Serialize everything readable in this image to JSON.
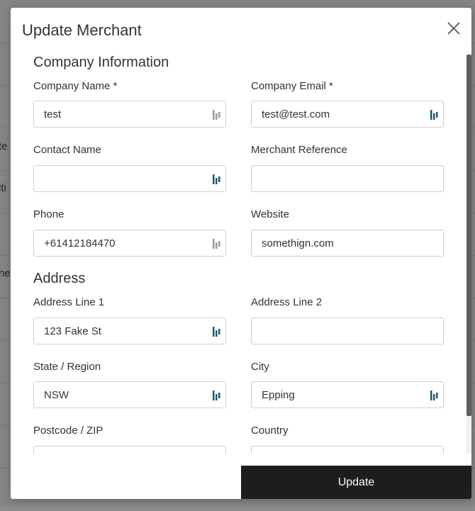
{
  "background": {
    "fragments": [
      "te",
      "lti",
      "ne"
    ]
  },
  "modal": {
    "title": "Update Merchant",
    "close_icon": "close-icon",
    "submit_label": "Update"
  },
  "sections": {
    "company": "Company Information",
    "address": "Address"
  },
  "fields": {
    "company_name": {
      "label": "Company Name *",
      "value": ""
    },
    "company_email": {
      "label": "Company Email *",
      "value": "test@test.com"
    },
    "contact_name": {
      "label": "Contact Name",
      "value": ""
    },
    "merchant_reference": {
      "label": "Merchant Reference",
      "value": ""
    },
    "phone": {
      "label": "Phone",
      "value": "+61412184470"
    },
    "website": {
      "label": "Website",
      "value": "somethign.com"
    },
    "address_line_1": {
      "label": "Address Line 1",
      "value": "123 Fake St"
    },
    "address_line_2": {
      "label": "Address Line 2",
      "value": ""
    },
    "state_region": {
      "label": "State / Region",
      "value": "NSW"
    },
    "city": {
      "label": "City",
      "value": "Epping"
    },
    "postcode": {
      "label": "Postcode / ZIP",
      "value": ""
    },
    "country": {
      "label": "Country",
      "value": ""
    }
  },
  "company_name_value": "test",
  "colors": {
    "primary_button": "#1d1d1d",
    "password_icon_active": "#1b5c6b",
    "password_icon_inactive": "#9a9a9a"
  }
}
